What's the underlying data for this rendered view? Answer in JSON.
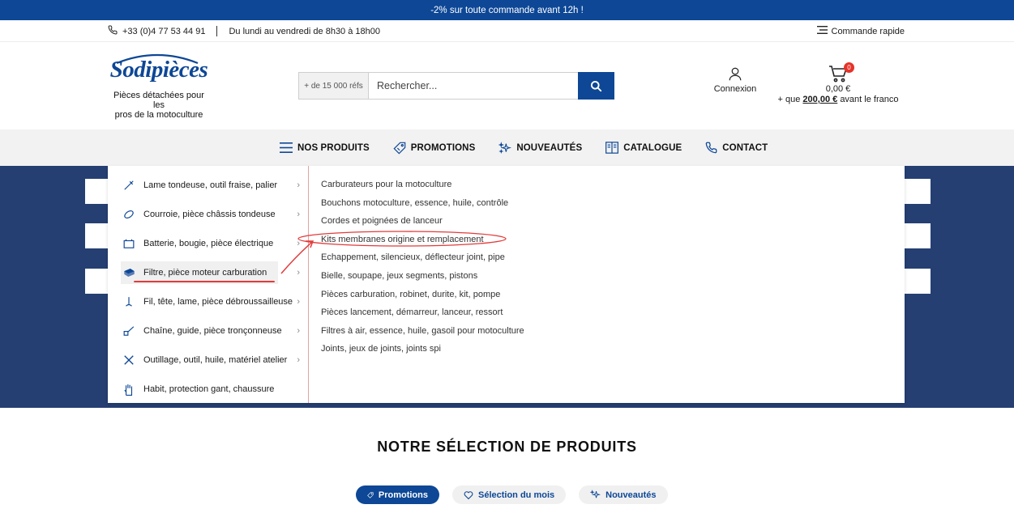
{
  "promo_bar": {
    "text": "-2% sur toute commande avant 12h !"
  },
  "info_bar": {
    "phone": "+33 (0)4 77 53 44 91",
    "hours": "Du lundi au vendredi de 8h30 à 18h00",
    "quick_order": "Commande rapide"
  },
  "header": {
    "logo_text": "Sodipièces",
    "tagline_line1": "Pièces détachées pour les",
    "tagline_line2": "pros de la motoculture",
    "search": {
      "refs": "+ de 15 000 réfs",
      "placeholder": "Rechercher..."
    },
    "account_label": "Connexion",
    "cart": {
      "count": "0",
      "total": "0,00 €",
      "free_prefix": "+ que",
      "free_amount": "200,00 €",
      "free_suffix": "avant le franco"
    }
  },
  "nav": {
    "items": [
      {
        "label": "NOS PRODUITS",
        "icon": "hamburger-icon"
      },
      {
        "label": "PROMOTIONS",
        "icon": "tag-icon"
      },
      {
        "label": "NOUVEAUTÉS",
        "icon": "sparkle-icon"
      },
      {
        "label": "CATALOGUE",
        "icon": "catalog-icon"
      },
      {
        "label": "CONTACT",
        "icon": "phone-icon"
      }
    ]
  },
  "mega_menu": {
    "categories": [
      {
        "label": "Lame tondeuse, outil fraise, palier",
        "icon": "blade-icon"
      },
      {
        "label": "Courroie, pièce châssis tondeuse",
        "icon": "belt-icon"
      },
      {
        "label": "Batterie, bougie, pièce électrique",
        "icon": "battery-icon"
      },
      {
        "label": "Filtre, pièce moteur carburation",
        "icon": "filter-icon"
      },
      {
        "label": "Fil, tête, lame, pièce débroussailleuse",
        "icon": "trimmer-icon"
      },
      {
        "label": "Chaîne, guide, pièce tronçonneuse",
        "icon": "chainsaw-icon"
      },
      {
        "label": "Outillage, outil, huile, matériel atelier",
        "icon": "tools-icon"
      },
      {
        "label": "Habit, protection gant, chaussure",
        "icon": "glove-icon"
      }
    ],
    "active_index": 3,
    "subcategories": [
      "Carburateurs pour la motoculture",
      "Bouchons motoculture, essence, huile, contrôle",
      "Cordes et poignées de lanceur",
      "Kits membranes origine et remplacement",
      "Echappement, silencieux, déflecteur joint, pipe",
      "Bielle, soupape, jeux segments, pistons",
      "Pièces carburation, robinet, durite, kit, pompe",
      "Pièces lancement, démarreur, lanceur, ressort",
      "Filtres à air, essence, huile, gasoil pour motoculture",
      "Joints, jeux de joints, joints spi"
    ]
  },
  "selection": {
    "title": "NOTRE SÉLECTION DE PRODUITS",
    "tabs": [
      {
        "label": "Promotions",
        "icon": "tag-icon"
      },
      {
        "label": "Sélection du mois",
        "icon": "heart-icon"
      },
      {
        "label": "Nouveautés",
        "icon": "sparkle-icon"
      }
    ]
  },
  "colors": {
    "brand_blue": "#0d4796",
    "hero_blue": "#253f72",
    "annotation_red": "#e23b3b"
  }
}
